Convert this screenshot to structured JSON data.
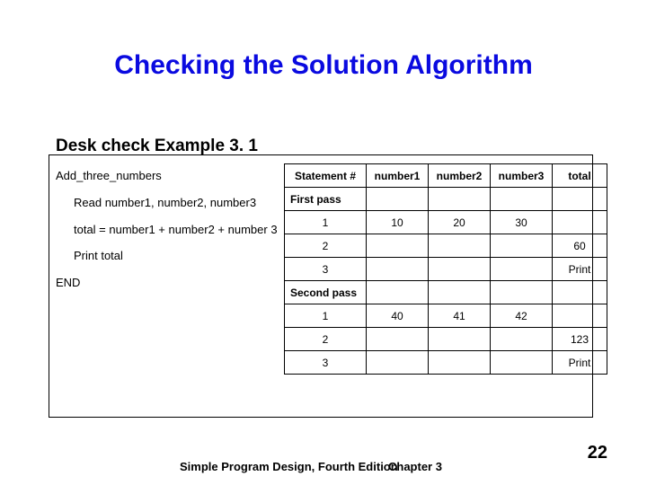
{
  "title": "Checking the Solution Algorithm",
  "subtitle": "Desk check Example 3. 1",
  "pseudocode": {
    "name": "Add_three_numbers",
    "line1": "Read number1, number2, number3",
    "line2": "total = number1 + number2 + number 3",
    "line3": "Print total",
    "end": "END"
  },
  "chart_data": {
    "type": "table",
    "headers": [
      "Statement #",
      "number1",
      "number2",
      "number3",
      "total"
    ],
    "rows": [
      {
        "stmt": "First pass",
        "n1": "",
        "n2": "",
        "n3": "",
        "total": "",
        "left": true
      },
      {
        "stmt": "1",
        "n1": "10",
        "n2": "20",
        "n3": "30",
        "total": "",
        "left": false
      },
      {
        "stmt": "2",
        "n1": "",
        "n2": "",
        "n3": "",
        "total": "60",
        "left": false
      },
      {
        "stmt": "3",
        "n1": "",
        "n2": "",
        "n3": "",
        "total": "Print",
        "left": false
      },
      {
        "stmt": "Second pass",
        "n1": "",
        "n2": "",
        "n3": "",
        "total": "",
        "left": true
      },
      {
        "stmt": "1",
        "n1": "40",
        "n2": "41",
        "n3": "42",
        "total": "",
        "left": false
      },
      {
        "stmt": "2",
        "n1": "",
        "n2": "",
        "n3": "",
        "total": "123",
        "left": false
      },
      {
        "stmt": "3",
        "n1": "",
        "n2": "",
        "n3": "",
        "total": "Print",
        "left": false
      }
    ]
  },
  "footer": {
    "book": "Simple Program Design, Fourth Edition",
    "chapter": "Chapter 3",
    "page": "22"
  }
}
